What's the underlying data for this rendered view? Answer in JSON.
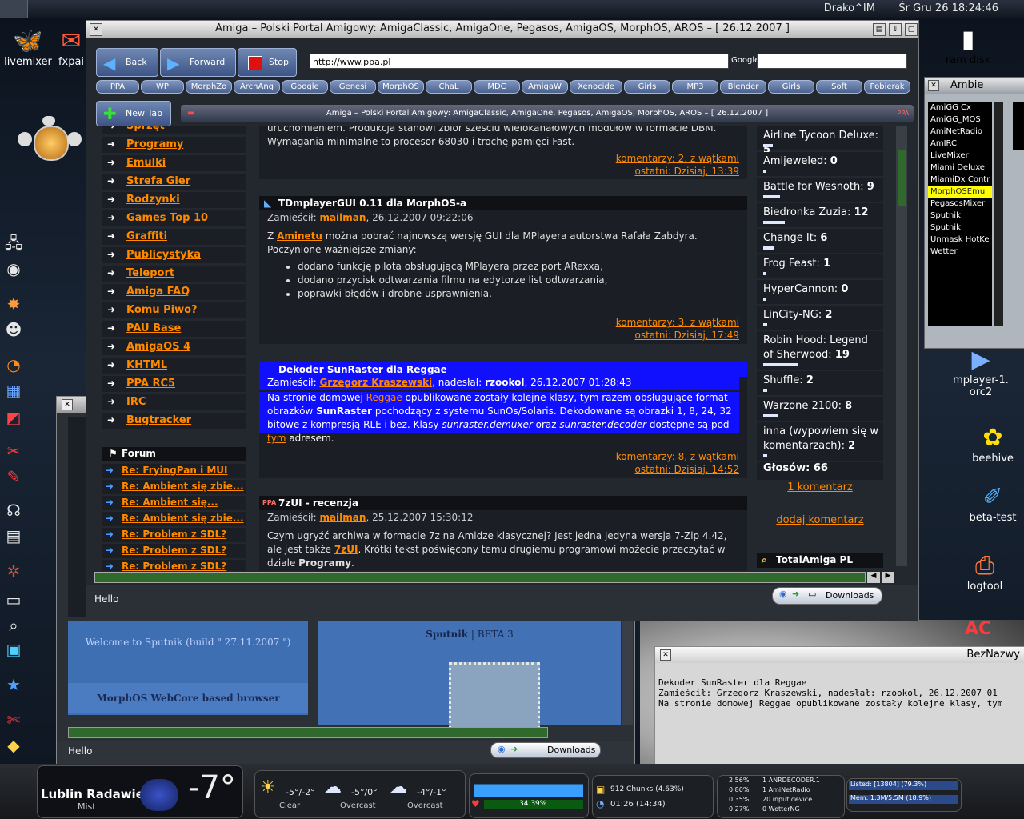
{
  "menubar": {
    "user": "Drako^IM",
    "clock": "Śr Gru 26 18:24:46"
  },
  "desktop_left": [
    {
      "label": "livemixer",
      "icon": "butterfly-icon"
    },
    {
      "label": "fxpai",
      "icon": "paint-icon"
    }
  ],
  "desktop_right": [
    {
      "label": "ram disk",
      "icon": "disk-icon"
    },
    {
      "label": "mplayer-1.\norc2",
      "icon": "play-icon"
    },
    {
      "label": "beehive",
      "icon": "flower-icon"
    },
    {
      "label": "beta-test",
      "icon": "pen-icon"
    },
    {
      "label": "logtool",
      "icon": "log-icon"
    }
  ],
  "main_window": {
    "title": "Amiga – Polski Portal Amigowy: AmigaClassic, AmigaOne, Pegasos, AmigaOS, MorphOS, AROS – [ 26.12.2007 ]",
    "back": "Back",
    "forward": "Forward",
    "stop": "Stop",
    "url": "http://www.ppa.pl",
    "google_label": "Google",
    "google_value": "",
    "bookmarks": [
      "PPA",
      "WP",
      "MorphZo",
      "ArchAng",
      "Google",
      "Genesi",
      "MorphOS",
      "ChaL",
      "MDC",
      "AmigaW",
      "Xenocide",
      "Girls",
      "MP3",
      "Blender",
      "Girls",
      "Soft",
      "Pobierak"
    ],
    "new_tab": "New Tab",
    "tab_title": "Amiga – Polski Portal Amigowy: AmigaClassic, AmigaOne, Pegasos, AmigaOS, MorphOS, AROS – [ 26.12.2007 ]",
    "status": "Hello",
    "downloads": "Downloads"
  },
  "nav": [
    "Sprzęt",
    "Programy",
    "Emulki",
    "Strefa Gier",
    "Rodzynki",
    "Games Top 10",
    "Graffiti",
    "Publicystyka",
    "Teleport",
    "Amiga FAQ",
    "Komu Piwo?",
    "PAU Base",
    "AmigaOS 4",
    "KHTML",
    "PPA RC5",
    "IRC",
    "Bugtracker"
  ],
  "forum": {
    "title": "Forum",
    "items": [
      "Re: FryingPan i MUI",
      "Re: Ambient się zbie...",
      "Re: Ambient się...",
      "Re: Ambient się zbie...",
      "Re: Problem z SDL?",
      "Re: Problem z SDL?",
      "Re: Problem z SDL?"
    ]
  },
  "news": [
    {
      "title": "",
      "partial_body": "uruchomieniem. Produkcja stanowi zbiór sześciu wielokanałowych modułów w formacie DBM. Wymagania minimalne to procesor 68030 i trochę pamięci Fast.",
      "comments": "komentarzy: 2, z wątkami",
      "latest": "ostatni: Dzisiaj, 13:39"
    },
    {
      "title": "TDmplayerGUI 0.11 dla MorphOS-a",
      "meta_prefix": "Zamieścił:",
      "author": "mailman",
      "date": ", 26.12.2007 09:22:06",
      "intro_pre": "Z",
      "intro_link": "Aminetu",
      "intro_post": "można pobrać najnowszą wersję GUI dla MPlayera autorstwa Rafała Zabdyra. Poczynione ważniejsze zmiany:",
      "bullets": [
        "dodano funkcję pilota obsługującą MPlayera przez port ARexxa,",
        "dodano przycisk odtwarzania filmu na edytorze list odtwarzania,",
        "poprawki błędów i drobne usprawnienia."
      ],
      "comments": "komentarzy: 3, z wątkami",
      "latest": "ostatni: Dzisiaj, 17:49"
    },
    {
      "title": "Dekoder SunRaster dla Reggae",
      "meta_prefix": "Zamieścił:",
      "author": "Grzegorz Kraszewski",
      "sent_prefix": ", nadesłał:",
      "sender": "rzookol",
      "date": ", 26.12.2007 01:28:43",
      "body1": "Na stronie domowej",
      "body_link": "Reggae",
      "body2": "opublikowane zostały kolejne klasy, tym razem obsługujące format obrazków",
      "body_bold": "SunRaster",
      "body3": "pochodzący z systemu SunOs/Solaris. Dekodowane są obrazki 1, 8, 24, 32 bitowe z kompresją RLE i bez. Klasy",
      "body_italic1": "sunraster.demuxer",
      "body4": "oraz",
      "body_italic2": "sunraster.decoder",
      "body5": "dostępne są pod",
      "body_link2": "tym",
      "body6": "adresem.",
      "comments": "komentarzy: 8, z wątkami",
      "latest": "ostatni: Dzisiaj, 14:52"
    },
    {
      "title": "7zUI - recenzja",
      "meta_prefix": "Zamieścił:",
      "author": "mailman",
      "date": ", 25.12.2007 15:30:12",
      "body1": "Czym ugryźć archiwa w formacie 7z na Amidze klasycznej? Jest jedna jedyna wersja 7-Zip 4.42, ale jest także",
      "body_link": "7zUI",
      "body2": ". Krótki tekst poświęcony temu drugiemu programowi możecie przeczytać w dziale",
      "body_bold": "Programy",
      "body3": "."
    }
  ],
  "poll": {
    "items": [
      {
        "name": "Airline Tycoon Deluxe:",
        "votes": "5",
        "bar_fraction": 0.08
      },
      {
        "name": "Amijeweled:",
        "votes": "0",
        "bar_fraction": 0.0
      },
      {
        "name": "Battle for Wesnoth:",
        "votes": "9",
        "bar_fraction": 0.14
      },
      {
        "name": "Biedronka Zuzia:",
        "votes": "12",
        "bar_fraction": 0.18
      },
      {
        "name": "Change It:",
        "votes": "6",
        "bar_fraction": 0.09
      },
      {
        "name": "Frog Feast:",
        "votes": "1",
        "bar_fraction": 0.02
      },
      {
        "name": "HyperCannon:",
        "votes": "0",
        "bar_fraction": 0.0
      },
      {
        "name": "LinCity-NG:",
        "votes": "2",
        "bar_fraction": 0.03
      },
      {
        "name": "Robin Hood: Legend of Sherwood:",
        "votes": "19",
        "bar_fraction": 0.29
      },
      {
        "name": "Shuffle:",
        "votes": "2",
        "bar_fraction": 0.03
      },
      {
        "name": "Warzone 2100:",
        "votes": "8",
        "bar_fraction": 0.12
      },
      {
        "name": "inna (wypowiem się w komentarzach):",
        "votes": "2",
        "bar_fraction": 0.03
      }
    ],
    "total_label": "Głosów: 66",
    "comments_link": "1 komentarz",
    "add_comment": "dodaj komentarz",
    "next_box": "TotalAmiga PL"
  },
  "sputnik": {
    "welcome": "Welcome to Sputnik (build \" 27.11.2007 \")",
    "webcore": "MorphOS WebCore based browser",
    "brand": "Sputnik",
    "beta": "| BETA 3",
    "status": "Hello",
    "downloads": "Downloads"
  },
  "terminal": {
    "title": "BezNazwy",
    "lines": [
      "Dekoder SunRaster dla Reggae",
      "",
      "Zamieścił: Grzegorz Kraszewski, nadesłał: rzookol, 26.12.2007 01",
      "Na stronie domowej Reggae opublikowane zostały kolejne klasy, tym"
    ]
  },
  "mixer": {
    "title": "Ambie",
    "items": [
      "AmiGG Cx",
      "AmiGG_MOS",
      "AmiNetRadio",
      "AmIRC",
      "LiveMixer",
      "Miami Deluxe",
      "MiamiDx Contr",
      "MorphOSEmu",
      "PegasosMixer",
      "Sputnik",
      "Sputnik",
      "Unmask HotKe",
      "Wetter"
    ],
    "selected_index": 7
  },
  "dock": {
    "weather_city": "Lublin Radawie",
    "weather_cond": "Mist",
    "temp": "-7°",
    "forecast": [
      {
        "range": "-5°/-2°",
        "cond": "Clear"
      },
      {
        "range": "-5°/0°",
        "cond": "Overcast"
      },
      {
        "range": "-4°/-1°",
        "cond": "Overcast"
      }
    ],
    "cpu_pct": "34.39%",
    "chunks": "912 Chunks (4.63%)",
    "uptime": "01:26 (14:34)",
    "procs": [
      {
        "pct": "2.56%",
        "name": "1 ANRDECODER.1"
      },
      {
        "pct": "0.80%",
        "name": "1 AmiNetRadio"
      },
      {
        "pct": "0.35%",
        "name": "20 input.device"
      },
      {
        "pct": "0.27%",
        "name": "0 WetterNG"
      }
    ],
    "listed": "Listed: [13804] (79.3%)",
    "mem": "Mem: 1.3M/5.5M (18.9%)"
  }
}
